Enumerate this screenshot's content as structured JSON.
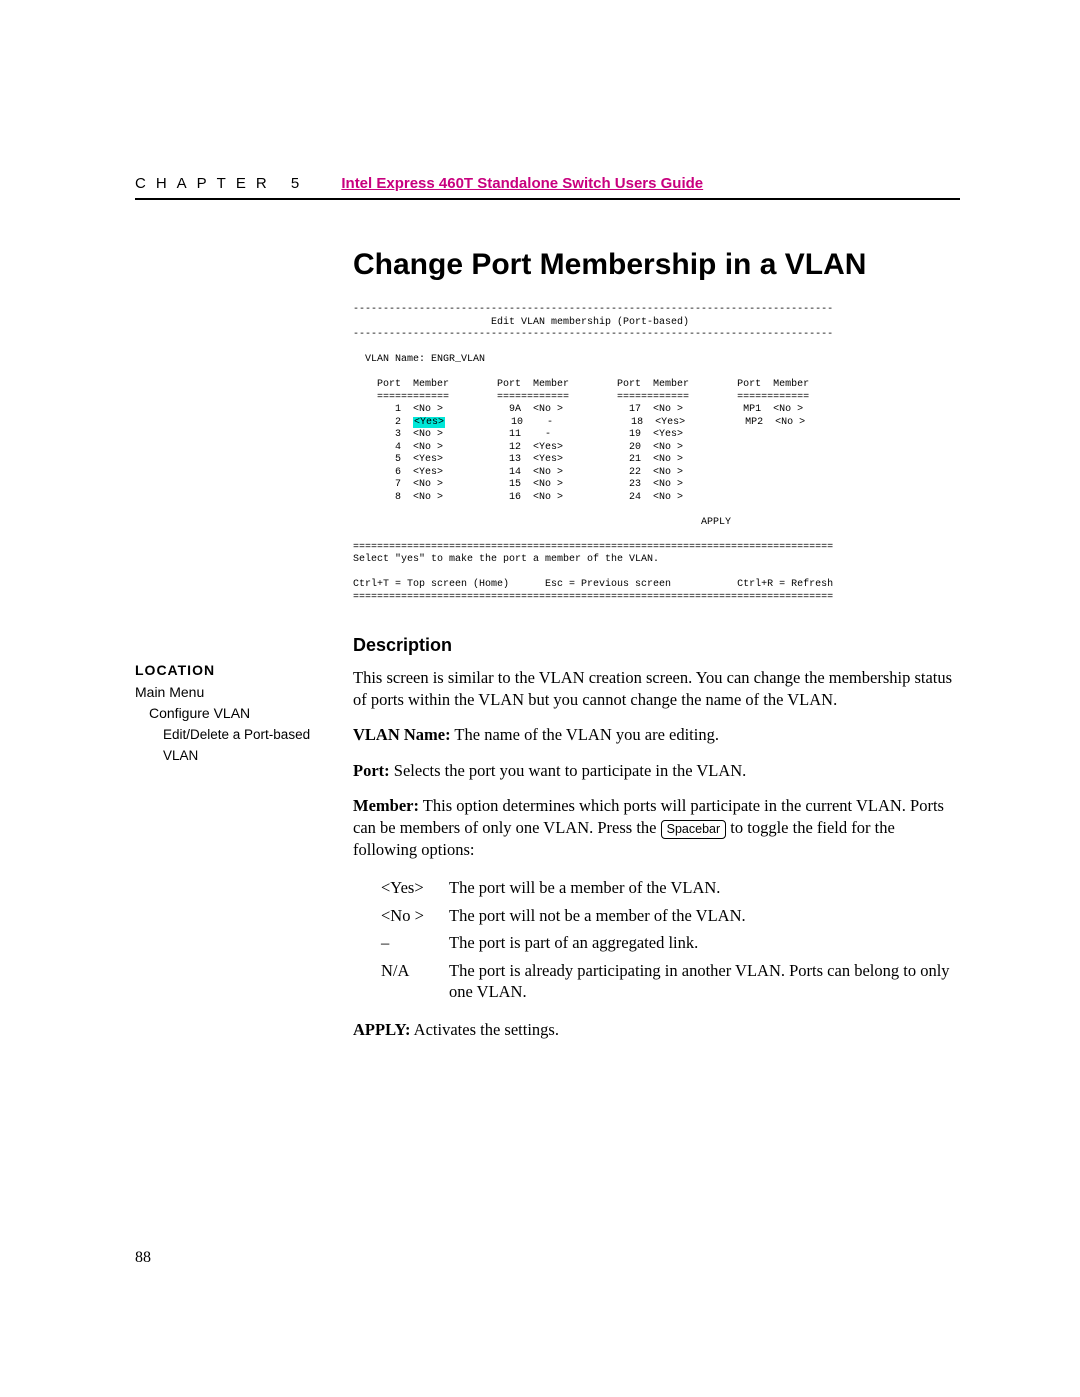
{
  "header": {
    "chapter": "CHAPTER 5",
    "doc_title": "Intel Express 460T Standalone Switch Users Guide"
  },
  "title": "Change Port Membership in a VLAN",
  "terminal": {
    "title": "Edit VLAN membership (Port-based)",
    "vlan_label": "VLAN Name:",
    "vlan_name": "ENGR_VLAN",
    "col_port": "Port",
    "col_member": "Member",
    "highlighted": "<Yes>",
    "columns": [
      [
        {
          "port": "1",
          "member": "<No >"
        },
        {
          "port": "2",
          "member": "<Yes>"
        },
        {
          "port": "3",
          "member": "<No >"
        },
        {
          "port": "4",
          "member": "<No >"
        },
        {
          "port": "5",
          "member": "<Yes>"
        },
        {
          "port": "6",
          "member": "<Yes>"
        },
        {
          "port": "7",
          "member": "<No >"
        },
        {
          "port": "8",
          "member": "<No >"
        }
      ],
      [
        {
          "port": "9A",
          "member": "<No >"
        },
        {
          "port": "10",
          "member": "-"
        },
        {
          "port": "11",
          "member": "-"
        },
        {
          "port": "12",
          "member": "<Yes>"
        },
        {
          "port": "13",
          "member": "<Yes>"
        },
        {
          "port": "14",
          "member": "<No >"
        },
        {
          "port": "15",
          "member": "<No >"
        },
        {
          "port": "16",
          "member": "<No >"
        }
      ],
      [
        {
          "port": "17",
          "member": "<No >"
        },
        {
          "port": "18",
          "member": "<Yes>"
        },
        {
          "port": "19",
          "member": "<Yes>"
        },
        {
          "port": "20",
          "member": "<No >"
        },
        {
          "port": "21",
          "member": "<No >"
        },
        {
          "port": "22",
          "member": "<No >"
        },
        {
          "port": "23",
          "member": "<No >"
        },
        {
          "port": "24",
          "member": "<No >"
        }
      ],
      [
        {
          "port": "MP1",
          "member": "<No >"
        },
        {
          "port": "MP2",
          "member": "<No >"
        }
      ]
    ],
    "apply": "APPLY",
    "hint": "Select \"yes\" to make the port a member of the VLAN.",
    "foot_left": "Ctrl+T = Top screen (Home)",
    "foot_mid": "Esc = Previous screen",
    "foot_right": "Ctrl+R = Refresh"
  },
  "sidebar": {
    "heading": "LOCATION",
    "items": [
      "Main Menu",
      "Configure VLAN",
      "Edit/Delete a Port-based VLAN"
    ]
  },
  "description": {
    "heading": "Description",
    "intro": "This screen is similar to the VLAN creation screen. You can change the membership status of ports within the VLAN but you cannot change the name of the VLAN.",
    "vlan_name_label": "VLAN Name:",
    "vlan_name_text": " The name of the VLAN you are editing.",
    "port_label": "Port:",
    "port_text": " Selects the port you want to participate in the VLAN.",
    "member_label": "Member:",
    "member_text_pre": " This option determines which ports will participate in the current VLAN. Ports can be members of only one VLAN. Press the ",
    "keycap": "Spacebar",
    "member_text_post": " to toggle the field for the following options:",
    "options": [
      {
        "k": "<Yes>",
        "v": "The port will be a member of the VLAN."
      },
      {
        "k": "<No >",
        "v": "The port will not be a member of the VLAN."
      },
      {
        "k": "–",
        "v": "The port is part of an aggregated link."
      },
      {
        "k": "N/A",
        "v": "The port is already participating in another VLAN. Ports can belong to only one VLAN."
      }
    ],
    "apply_label": "APPLY:",
    "apply_text": " Activates the settings."
  },
  "page_number": "88"
}
